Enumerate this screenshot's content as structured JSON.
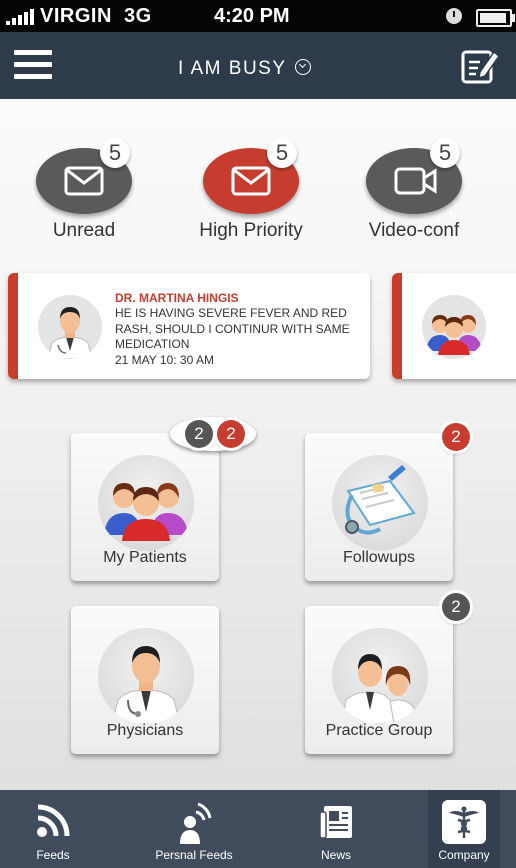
{
  "status_bar": {
    "carrier": "VIRGIN",
    "network": "3G",
    "time": "4:20 PM"
  },
  "navbar": {
    "title": "I AM  BUSY"
  },
  "stats": [
    {
      "label": "Unread",
      "count": "5",
      "color": "#5a5a5a",
      "icon": "envelope-icon"
    },
    {
      "label": "High Priority",
      "count": "5",
      "color": "#c63d2f",
      "icon": "envelope-icon"
    },
    {
      "label": "Video-conf",
      "count": "5",
      "color": "#5a5a5a",
      "icon": "video-camera-icon"
    }
  ],
  "message": {
    "sender": "DR. MARTINA HINGIS",
    "text": "HE IS HAVING SEVERE FEVER AND RED RASH, SHOULD I CONTINUR WITH SAME MEDICATION",
    "date": "21 MAY 10: 30 AM"
  },
  "tiles": [
    {
      "label": "My Patients",
      "icon": "patients-group-icon",
      "badges": [
        "2",
        "2"
      ]
    },
    {
      "label": "Followups",
      "icon": "clipboard-stethoscope-icon",
      "badges": [
        "2"
      ]
    },
    {
      "label": "Physicians",
      "icon": "doctor-icon",
      "badges": []
    },
    {
      "label": "Practice Group",
      "icon": "doctors-group-icon",
      "badges": [
        "2"
      ]
    }
  ],
  "tabs": [
    {
      "label": "Feeds",
      "icon": "rss-icon"
    },
    {
      "label": "Persnal Feeds",
      "icon": "person-broadcast-icon"
    },
    {
      "label": "News",
      "icon": "newspaper-icon"
    },
    {
      "label": "Company",
      "icon": "caduceus-icon",
      "active": true
    }
  ],
  "colors": {
    "navbar": "#2e3b4a",
    "tabbar": "#404c5b",
    "accent_red": "#c63d2f",
    "dark_gray": "#5a5a5a"
  }
}
